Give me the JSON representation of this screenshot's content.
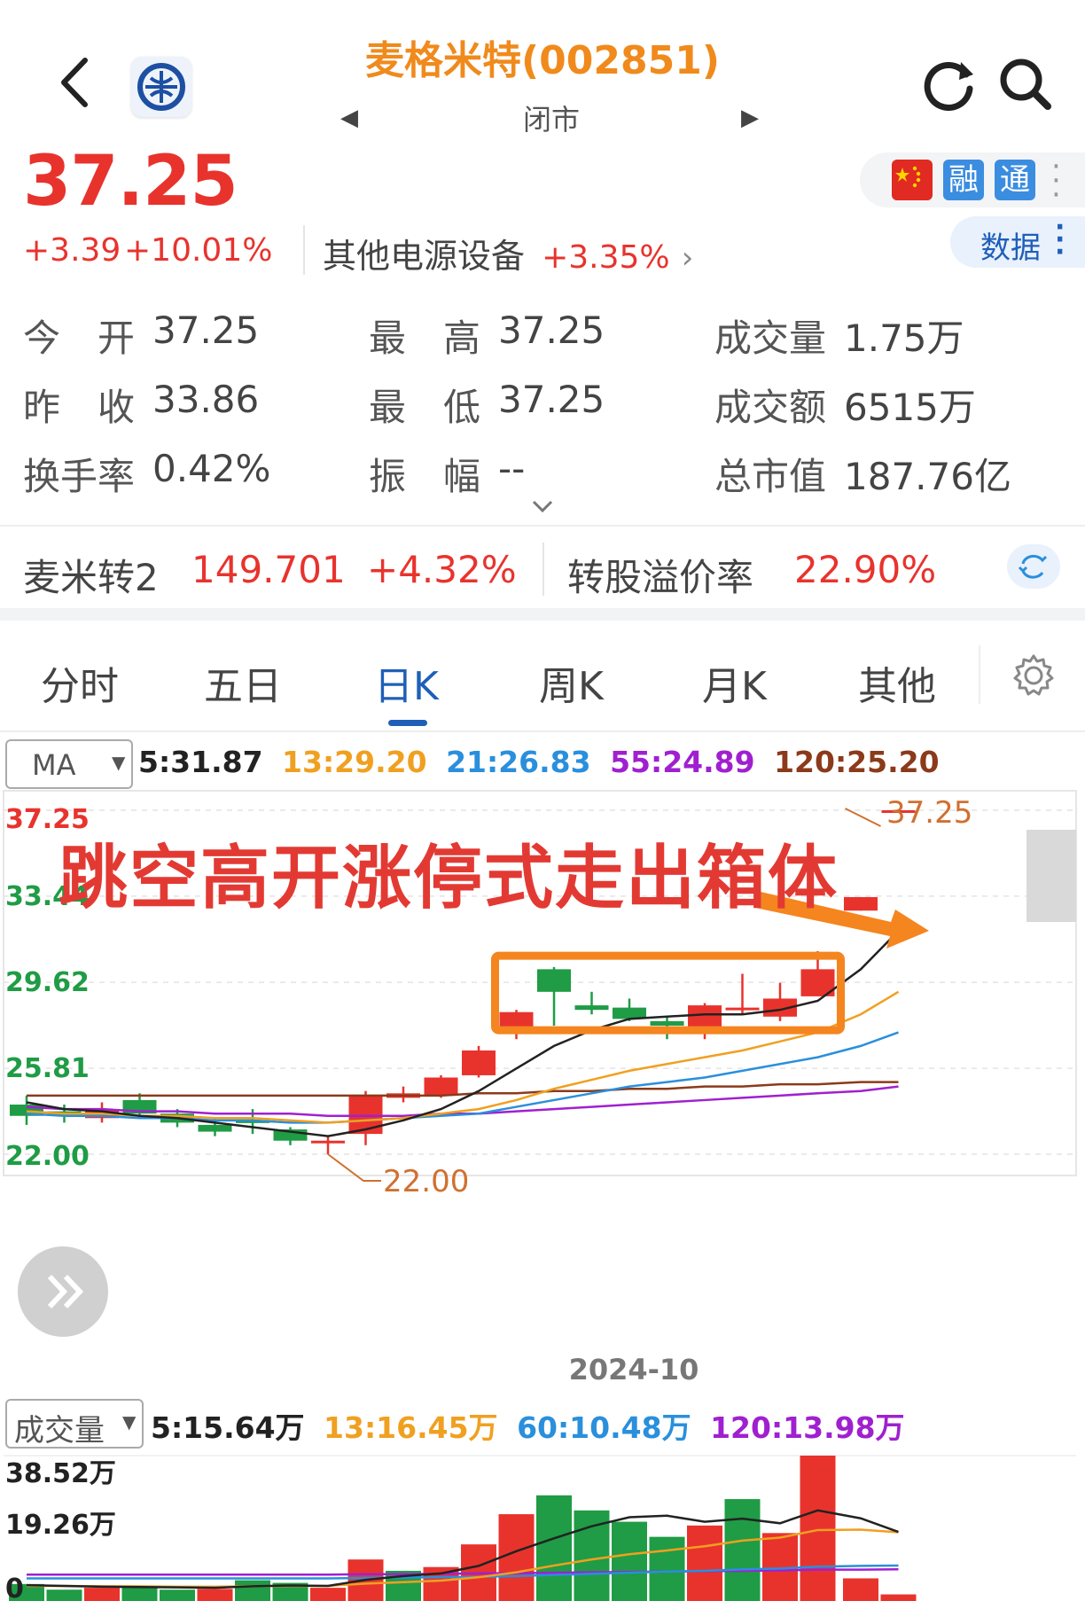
{
  "header": {
    "title": "麦格米特(002851)",
    "status": "闭市",
    "back_icon": "back-chevron-icon",
    "logo_icon": "company-logo-icon",
    "refresh_icon": "refresh-icon",
    "search_icon": "search-icon"
  },
  "quote": {
    "price": "37.25",
    "change": "+3.39",
    "change_pct": "+10.01%",
    "sector_name": "其他电源设备",
    "sector_change": "+3.35%",
    "badges": [
      "融",
      "通"
    ],
    "data_button": "数据"
  },
  "stats": [
    {
      "label": "今　开",
      "value": "37.25"
    },
    {
      "label": "最　高",
      "value": "37.25"
    },
    {
      "label": "成交量",
      "value": "1.75万"
    },
    {
      "label": "昨　收",
      "value": "33.86"
    },
    {
      "label": "最　低",
      "value": "37.25"
    },
    {
      "label": "成交额",
      "value": "6515万"
    },
    {
      "label": "换手率",
      "value": "0.42%"
    },
    {
      "label": "振　幅",
      "value": "--"
    },
    {
      "label": "总市值",
      "value": "187.76亿"
    }
  ],
  "bond": {
    "name": "麦米转2",
    "price": "149.701",
    "change_pct": "+4.32%",
    "premium_label": "转股溢价率",
    "premium_value": "22.90%"
  },
  "tabs": [
    "分时",
    "五日",
    "日K",
    "周K",
    "月K",
    "其他"
  ],
  "active_tab": "日K",
  "ma_bar": {
    "selector": "MA",
    "items": [
      {
        "text": "5:31.87",
        "color": "#222222"
      },
      {
        "text": "13:29.20",
        "color": "#f0a020"
      },
      {
        "text": "21:26.83",
        "color": "#2a8fdc"
      },
      {
        "text": "55:24.89",
        "color": "#a020d0"
      },
      {
        "text": "120:25.20",
        "color": "#8b3a1a"
      }
    ]
  },
  "annotation": "跳空高开涨停式走出箱体",
  "date_label": "2024-10",
  "volume_bar": {
    "selector": "成交量",
    "items": [
      {
        "text": "5:15.64万",
        "color": "#222222"
      },
      {
        "text": "13:16.45万",
        "color": "#f0a020"
      },
      {
        "text": "60:10.48万",
        "color": "#2a8fdc"
      },
      {
        "text": "120:13.98万",
        "color": "#a020d0"
      }
    ]
  },
  "chart_data": {
    "type": "candlestick",
    "y_labels": [
      "37.25",
      "33.44",
      "29.62",
      "25.81",
      "22.00"
    ],
    "ylim": [
      22.0,
      37.25
    ],
    "high_marker": "37.25",
    "low_marker": "22.00",
    "colors": {
      "up": "#e8332d",
      "down": "#1f9c45"
    },
    "candles": [
      {
        "o": 24.2,
        "c": 23.7,
        "h": 24.6,
        "l": 23.3
      },
      {
        "o": 23.9,
        "c": 23.7,
        "h": 24.2,
        "l": 23.4
      },
      {
        "o": 23.6,
        "c": 24.0,
        "h": 24.3,
        "l": 23.4
      },
      {
        "o": 24.4,
        "c": 23.8,
        "h": 24.7,
        "l": 23.6
      },
      {
        "o": 23.8,
        "c": 23.4,
        "h": 24.0,
        "l": 23.2
      },
      {
        "o": 23.3,
        "c": 23.0,
        "h": 23.6,
        "l": 22.8
      },
      {
        "o": 23.5,
        "c": 23.4,
        "h": 24.0,
        "l": 22.9
      },
      {
        "o": 23.1,
        "c": 22.6,
        "h": 23.2,
        "l": 22.4
      },
      {
        "o": 22.5,
        "c": 22.6,
        "h": 22.8,
        "l": 22.0
      },
      {
        "o": 22.9,
        "c": 24.6,
        "h": 24.8,
        "l": 22.4
      },
      {
        "o": 24.5,
        "c": 24.7,
        "h": 25.0,
        "l": 24.3
      },
      {
        "o": 24.6,
        "c": 25.4,
        "h": 25.5,
        "l": 24.5
      },
      {
        "o": 25.5,
        "c": 26.6,
        "h": 26.8,
        "l": 25.4
      },
      {
        "o": 27.6,
        "c": 28.3,
        "h": 28.4,
        "l": 27.1
      },
      {
        "o": 30.2,
        "c": 29.2,
        "h": 30.3,
        "l": 27.7
      },
      {
        "o": 28.6,
        "c": 28.4,
        "h": 29.2,
        "l": 28.2
      },
      {
        "o": 28.5,
        "c": 28.0,
        "h": 28.9,
        "l": 27.9
      },
      {
        "o": 27.9,
        "c": 27.7,
        "h": 28.1,
        "l": 27.1
      },
      {
        "o": 27.6,
        "c": 28.6,
        "h": 28.7,
        "l": 27.1
      },
      {
        "o": 28.4,
        "c": 28.5,
        "h": 30.0,
        "l": 28.2
      },
      {
        "o": 28.1,
        "c": 28.9,
        "h": 29.6,
        "l": 27.9
      },
      {
        "o": 29.0,
        "c": 30.2,
        "h": 31.0,
        "l": 29.0
      },
      {
        "o": 32.8,
        "c": 33.4,
        "h": 33.4,
        "l": 32.8
      },
      {
        "o": 37.25,
        "c": 37.25,
        "h": 37.25,
        "l": 37.25
      }
    ],
    "ma5": [
      24.3,
      24.0,
      23.9,
      23.7,
      23.6,
      23.4,
      23.2,
      23.0,
      22.8,
      23.1,
      23.5,
      24.0,
      24.8,
      25.8,
      26.8,
      27.5,
      28.0,
      28.1,
      28.2,
      28.2,
      28.4,
      28.8,
      30.2,
      31.9
    ],
    "ma13": [
      23.9,
      23.8,
      23.8,
      23.7,
      23.7,
      23.6,
      23.6,
      23.5,
      23.4,
      23.5,
      23.6,
      23.8,
      24.0,
      24.4,
      24.9,
      25.3,
      25.7,
      26.0,
      26.3,
      26.6,
      27.0,
      27.4,
      28.2,
      29.2
    ],
    "ma21": [
      23.8,
      23.7,
      23.7,
      23.6,
      23.6,
      23.5,
      23.5,
      23.4,
      23.4,
      23.5,
      23.6,
      23.7,
      23.8,
      24.1,
      24.4,
      24.7,
      25.0,
      25.2,
      25.4,
      25.7,
      26.0,
      26.3,
      26.8,
      27.4
    ],
    "ma55": [
      24.1,
      24.0,
      24.0,
      23.9,
      23.9,
      23.8,
      23.8,
      23.8,
      23.7,
      23.7,
      23.7,
      23.8,
      23.8,
      23.9,
      24.0,
      24.1,
      24.2,
      24.3,
      24.4,
      24.5,
      24.6,
      24.7,
      24.8,
      25.0
    ],
    "ma120": [
      24.6,
      24.6,
      24.6,
      24.6,
      24.6,
      24.6,
      24.6,
      24.6,
      24.6,
      24.6,
      24.6,
      24.6,
      24.7,
      24.7,
      24.8,
      24.8,
      24.9,
      24.9,
      25.0,
      25.0,
      25.1,
      25.1,
      25.2,
      25.2
    ],
    "volume": {
      "y_labels": [
        "38.52万",
        "19.26万",
        "0"
      ],
      "ymax": 38.52,
      "values": [
        4.5,
        3.0,
        3.5,
        4.0,
        3.0,
        3.2,
        5.5,
        4.8,
        3.5,
        11.0,
        8.0,
        9.0,
        15.0,
        23.0,
        28.0,
        24.0,
        21.0,
        17.0,
        20.0,
        27.0,
        18.0,
        38.52,
        6.0,
        1.75
      ],
      "up": [
        false,
        false,
        true,
        false,
        false,
        true,
        false,
        false,
        true,
        true,
        false,
        true,
        true,
        true,
        false,
        false,
        false,
        false,
        true,
        false,
        true,
        true,
        true,
        true
      ],
      "ma5": [
        4.2,
        4.0,
        3.8,
        3.7,
        3.6,
        3.5,
        3.9,
        4.1,
        4.0,
        5.6,
        6.6,
        7.3,
        9.3,
        13.2,
        16.6,
        19.8,
        22.2,
        22.6,
        21.0,
        21.8,
        20.6,
        24.0,
        21.9,
        18.3
      ],
      "ma13": [
        4.0,
        4.0,
        3.9,
        3.9,
        3.8,
        3.8,
        3.9,
        4.0,
        4.0,
        4.6,
        5.0,
        5.4,
        6.3,
        7.6,
        9.4,
        11.0,
        12.4,
        13.4,
        14.5,
        16.0,
        16.8,
        18.8,
        18.9,
        18.2
      ],
      "ma60": [
        6.0,
        6.0,
        6.0,
        6.0,
        6.0,
        6.0,
        6.0,
        6.0,
        6.0,
        6.1,
        6.2,
        6.3,
        6.4,
        6.6,
        6.9,
        7.2,
        7.5,
        7.8,
        8.0,
        8.4,
        8.6,
        9.1,
        9.3,
        9.4
      ],
      "ma120": [
        7.0,
        7.0,
        7.0,
        7.0,
        7.0,
        7.0,
        7.0,
        7.0,
        7.0,
        7.1,
        7.1,
        7.2,
        7.3,
        7.4,
        7.5,
        7.6,
        7.7,
        7.8,
        7.9,
        8.0,
        8.1,
        8.3,
        8.3,
        8.4
      ]
    }
  }
}
